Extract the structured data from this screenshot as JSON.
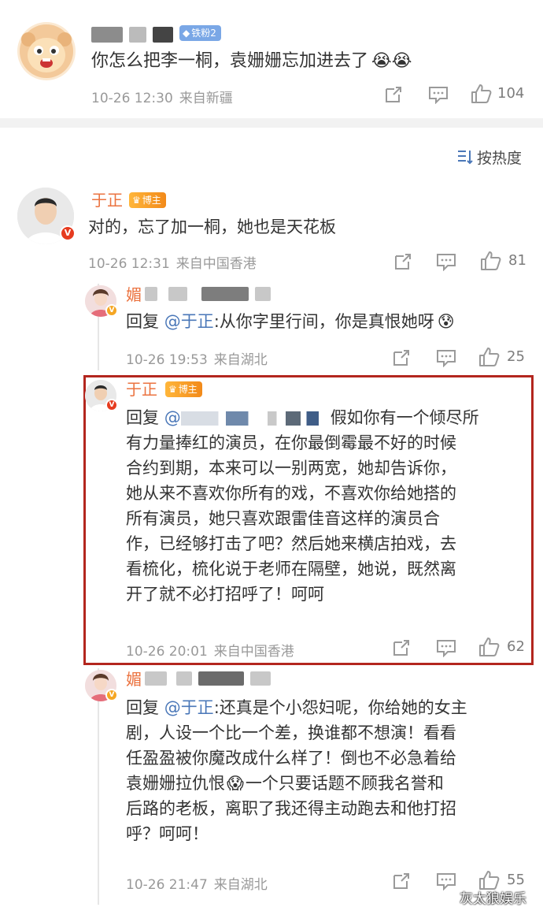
{
  "top_comment": {
    "badge": "铁粉2",
    "text": "你怎么把李一桐，袁姗姗忘加进去了",
    "time": "10-26 12:30",
    "location": "来自新疆",
    "likes": "104"
  },
  "sort": {
    "label": "按热度"
  },
  "main_comment": {
    "user": "于正",
    "badge": "博主",
    "text": "对的，忘了加一桐，她也是天花板",
    "time": "10-26 12:31",
    "location": "来自中国香港",
    "likes": "81"
  },
  "replies": [
    {
      "user_prefix": "媚",
      "reply_prefix": "回复",
      "mention": "@于正",
      "text": ":从你字里行间，你是真恨她呀",
      "time": "10-26 19:53",
      "location": "来自湖北",
      "likes": "25"
    },
    {
      "user": "于正",
      "badge": "博主",
      "reply_prefix": "回复",
      "mention": "@",
      "text_lines": [
        "假如你有一个倾尽所",
        "有力量捧红的演员，在你最倒霉最不好的时候",
        "合约到期，本来可以一别两宽，她却告诉你，",
        "她从来不喜欢你所有的戏，不喜欢你给她搭的",
        "所有演员，她只喜欢跟雷佳音这样的演员合",
        "作，已经够打击了吧？然后她来横店拍戏，去",
        "看梳化，梳化说于老师在隔壁，她说，既然离",
        "开了就不必打招呼了！呵呵"
      ],
      "time": "10-26 20:01",
      "location": "来自中国香港",
      "likes": "62"
    },
    {
      "user_prefix": "媚",
      "reply_prefix": "回复",
      "mention": "@于正",
      "text_lines": [
        ":还真是个小怨妇呢，你给她的女主",
        "剧，人设一个比一个差，换谁都不想演！看看",
        "任盈盈被你魔改成什么样了！倒也不必急着给",
        "袁姗姗拉仇恨",
        "一个只要话题不顾我名誉和",
        "后路的老板，离职了我还得主动跑去和他打招",
        "呼？呵呵！"
      ],
      "time": "10-26 21:47",
      "location": "来自湖北",
      "likes": "55"
    }
  ],
  "watermark": "灰太狼娱乐",
  "colors": {
    "name": "#eb7340",
    "mention": "#4a77b8",
    "meta": "#999999",
    "highlight_border": "#b3261e"
  }
}
